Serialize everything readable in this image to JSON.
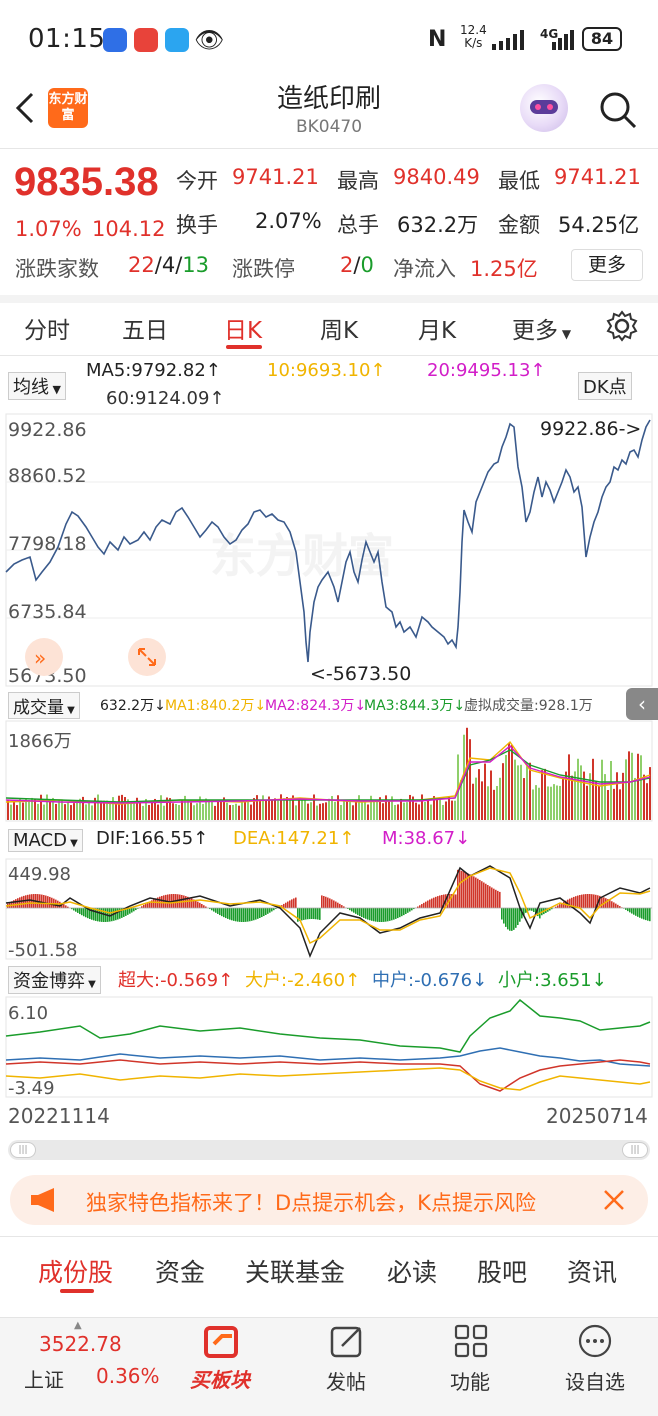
{
  "status_bar": {
    "time": "01:15",
    "net_speed": "12.4",
    "net_unit": "K/s",
    "network": "4G",
    "battery": "84"
  },
  "header": {
    "back_icon": "chevron-left-icon",
    "app_logo_text": "东方财富",
    "title": "造纸印刷",
    "code": "BK0470",
    "assistant_icon": "robot-icon",
    "search_icon": "search-icon"
  },
  "quote": {
    "price": "9835.38",
    "change_pct": "1.07%",
    "change": "104.12",
    "open_label": "今开",
    "open": "9741.21",
    "high_label": "最高",
    "high": "9840.49",
    "low_label": "最低",
    "low": "9741.21",
    "turnover_label": "换手",
    "turnover": "2.07%",
    "volume_label": "总手",
    "volume": "632.2万",
    "amount_label": "金额",
    "amount": "54.25亿",
    "updown_label": "涨跌家数",
    "up_count": "22",
    "sep1": "/",
    "flat_count": "4",
    "sep2": "/",
    "down_count": "13",
    "limit_label": "涨跌停",
    "limit_up": "2",
    "sep3": "/",
    "limit_down": "0",
    "netflow_label": "净流入",
    "netflow": "1.25亿",
    "more_label": "更多"
  },
  "period_tabs": [
    "分时",
    "五日",
    "日K",
    "周K",
    "月K",
    "更多"
  ],
  "active_period": "日K",
  "ma_bar": {
    "selector": "均线",
    "ma5": "MA5:9792.82↑",
    "ma10": "10:9693.10↑",
    "ma20": "20:9495.13↑",
    "ma60": "60:9124.09↑",
    "dk_button": "DK点"
  },
  "kline": {
    "y_ticks": [
      "9922.86",
      "8860.52",
      "7798.18",
      "6735.84",
      "5673.50"
    ],
    "max_marker": "9922.86->",
    "min_marker": "<-5673.50",
    "watermark": "东方财富"
  },
  "volume_bar": {
    "selector": "成交量",
    "vol": "632.2万↓",
    "ma1": "MA1:840.2万↓",
    "ma2": "MA2:824.3万↓",
    "ma3": "MA3:844.3万↓",
    "virtual": "虚拟成交量:928.1万",
    "y_max": "1866万"
  },
  "macd_bar": {
    "selector": "MACD",
    "dif": "DIF:166.55↑",
    "dea": "DEA:147.21↑",
    "m": "M:38.67↓",
    "y_max": "449.98",
    "y_min": "-501.58"
  },
  "fund_bar": {
    "selector": "资金博弈",
    "super": "超大:-0.569↑",
    "big": "大户:-2.460↑",
    "mid": "中户:-0.676↓",
    "small": "小户:3.651↓",
    "y_max": "6.10",
    "y_min": "-3.49"
  },
  "x_axis": {
    "start": "20221114",
    "end": "20250714"
  },
  "banner": {
    "text": "独家特色指标来了！D点提示机会，K点提示风险",
    "icon": "megaphone-icon"
  },
  "lower_tabs": [
    "成份股",
    "资金",
    "关联基金",
    "必读",
    "股吧",
    "资讯"
  ],
  "bottom_nav": {
    "index_value": "3522.78",
    "index_name": "上证",
    "index_pct": "0.36%",
    "buy_label": "买板块",
    "post_label": "发帖",
    "func_label": "功能",
    "watch_label": "设自选"
  },
  "colors": {
    "up_red": "#e0312b",
    "down_green": "#1a9c2b",
    "ma5": "#222222",
    "ma10": "#f0b400",
    "ma20": "#d21ec8",
    "ma60": "#333333",
    "brand_orange": "#ff6a1a"
  }
}
